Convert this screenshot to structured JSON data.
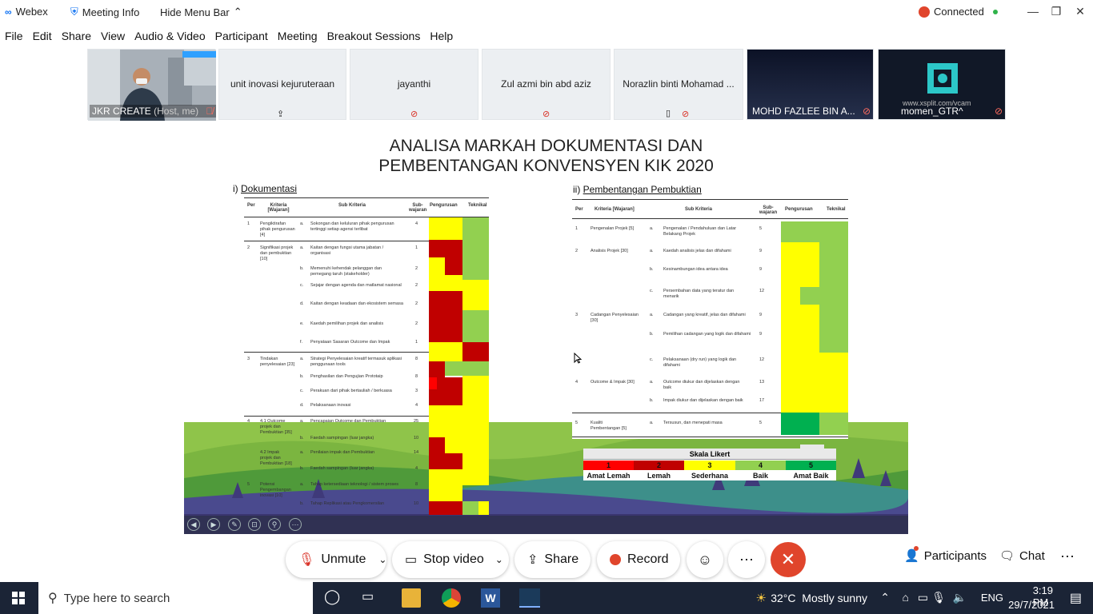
{
  "titlebar": {
    "app_name": "Webex",
    "meeting_info": "Meeting Info",
    "hide_menu": "Hide Menu Bar",
    "status": "Connected"
  },
  "menu": [
    "File",
    "Edit",
    "Share",
    "View",
    "Audio & Video",
    "Participant",
    "Meeting",
    "Breakout Sessions",
    "Help"
  ],
  "participants": [
    {
      "name": "JKR CREATE",
      "suffix": "(Host, me)"
    },
    {
      "name": "unit inovasi kejuruteraan"
    },
    {
      "name": "jayanthi"
    },
    {
      "name": "Zul azmi bin abd aziz"
    },
    {
      "name": "Norazlin binti Mohamad ..."
    },
    {
      "name": "MOHD FAZLEE BIN A..."
    },
    {
      "name": "momen_GTR^",
      "watermark": "www.xsplit.com/vcam"
    }
  ],
  "slide": {
    "title_line1": "ANALISA MARKAH DOKUMENTASI DAN",
    "title_line2": "PEMBENTANGAN KONVENSYEN KIK 2020",
    "left_section_prefix": "i)",
    "left_section": "Dokumentasi",
    "right_section_prefix": "ii)",
    "right_section": "Pembentangan Pembuktian",
    "headers": {
      "per": "Per",
      "kriteria": "Kriteria [Wajaran]",
      "sub_kriteria": "Sub Kriteria",
      "sub_wajaran": "Sub-wajaran",
      "pengurusan": "Pengurusan",
      "teknikal": "Teknikal"
    },
    "left_rows": [
      {
        "per": "1",
        "kriteria": "Pengiktirafan pihak pengurusan [4]",
        "sub": "a.",
        "text": "Sokongan dan keluluran pihak pengurusan tertinggi setiap agensi terlibat",
        "w": "4"
      },
      {
        "per": "2",
        "kriteria": "Signifikasi projek dan pembuktian [10]",
        "sub": "a.",
        "text": "Kaitan dengan fungsi utama jabatan / organisasi",
        "w": "1"
      },
      {
        "per": "",
        "kriteria": "",
        "sub": "b.",
        "text": "Memenuhi kehendak pelanggan dan pemegang taruh (stakeholder)",
        "w": "2"
      },
      {
        "per": "",
        "kriteria": "",
        "sub": "c.",
        "text": "Sejajar dengan agenda dan matlamat nasional",
        "w": "2"
      },
      {
        "per": "",
        "kriteria": "",
        "sub": "d.",
        "text": "Kaitan dengan keadaan dan ekosistem semasa",
        "w": "2"
      },
      {
        "per": "",
        "kriteria": "",
        "sub": "e.",
        "text": "Kaedah pemilihan projek dan analisis",
        "w": "2"
      },
      {
        "per": "",
        "kriteria": "",
        "sub": "f.",
        "text": "Penyataan Sasaran Outcome dan Impak",
        "w": "1"
      },
      {
        "per": "3",
        "kriteria": "Tindakan penyelesaian [23]",
        "sub": "a.",
        "text": "Strategi Penyelesaian kreatif termasuk aplikasi penggunaan tools",
        "w": "8"
      },
      {
        "per": "",
        "kriteria": "",
        "sub": "b.",
        "text": "Penghasilan dan Pengujian Prototaip",
        "w": "8"
      },
      {
        "per": "",
        "kriteria": "",
        "sub": "c.",
        "text": "Perakuan dari pihak bertauliah / berkuasa",
        "w": "3"
      },
      {
        "per": "",
        "kriteria": "",
        "sub": "d.",
        "text": "Pelaksanaan inovasi",
        "w": "4"
      },
      {
        "per": "4",
        "kriteria": "4.1 Outcome projek dan Pembuktian [35]",
        "sub": "a.",
        "text": "Pencapaian Outcome dan Pembuktian",
        "w": "25"
      },
      {
        "per": "",
        "kriteria": "",
        "sub": "b.",
        "text": "Faedah sampingan (luar jangka)",
        "w": "10"
      },
      {
        "per": "",
        "kriteria": "4.2 Impak projek dan Pembuktian [18]",
        "sub": "a.",
        "text": "Penilaian impak dan Pembuktian",
        "w": "14"
      },
      {
        "per": "",
        "kriteria": "",
        "sub": "b.",
        "text": "Faedah sampingan (luar jangka)",
        "w": "4"
      },
      {
        "per": "5",
        "kriteria": "Potensi Pengembangan inovasi [10]",
        "sub": "a.",
        "text": "Tahap ketersediaan teknologi / sistem proses",
        "w": "8"
      },
      {
        "per": "",
        "kriteria": "",
        "sub": "b.",
        "text": "Tahap Replikasi atau Pengkomersilan",
        "w": "10"
      }
    ],
    "right_rows": [
      {
        "per": "1",
        "kriteria": "Pengenalan Projek [5]",
        "sub": "a.",
        "text": "Pengenalan / Pendahuluan dan Latar Belakang Projek",
        "w": "5"
      },
      {
        "per": "2",
        "kriteria": "Analisis Projek [30]",
        "sub": "a.",
        "text": "Kaedah analisis jelas dan difahami",
        "w": "9"
      },
      {
        "per": "",
        "kriteria": "",
        "sub": "b.",
        "text": "Kesinambungan idea antara idea",
        "w": "9"
      },
      {
        "per": "",
        "kriteria": "",
        "sub": "c.",
        "text": "Persembahan data yang teratur dan menarik",
        "w": "12"
      },
      {
        "per": "3",
        "kriteria": "Cadangan Penyelesaian [30]",
        "sub": "a.",
        "text": "Cadangan yang kreatif, jelas dan difahami",
        "w": "9"
      },
      {
        "per": "",
        "kriteria": "",
        "sub": "b.",
        "text": "Pemilihan cadangan yang logik dan difahami",
        "w": "9"
      },
      {
        "per": "",
        "kriteria": "",
        "sub": "c.",
        "text": "Pelaksanaan (dry run) yang logik dan difahami",
        "w": "12"
      },
      {
        "per": "4",
        "kriteria": "Outcome & Impak [30]",
        "sub": "a.",
        "text": "Outcome diukur dan dijelaskan dengan baik",
        "w": "13"
      },
      {
        "per": "",
        "kriteria": "",
        "sub": "b.",
        "text": "Impak diukur dan dijelaskan dengan baik",
        "w": "17"
      },
      {
        "per": "5",
        "kriteria": "Kualiti Pembentangan [5]",
        "sub": "a.",
        "text": "Tersusun, dan menepati masa",
        "w": "5"
      }
    ],
    "likert": {
      "title": "Skala Likert",
      "levels": [
        {
          "n": "1",
          "label": "Amat Lemah",
          "color": "#ff0000"
        },
        {
          "n": "2",
          "label": "Lemah",
          "color": "#c00000"
        },
        {
          "n": "3",
          "label": "Sederhana",
          "color": "#ffff00"
        },
        {
          "n": "4",
          "label": "Baik",
          "color": "#92d050"
        },
        {
          "n": "5",
          "label": "Amat Baik",
          "color": "#00b050"
        }
      ]
    }
  },
  "controls": {
    "unmute": "Unmute",
    "stop_video": "Stop video",
    "share": "Share",
    "record": "Record",
    "participants": "Participants",
    "chat": "Chat"
  },
  "taskbar": {
    "search_placeholder": "Type here to search",
    "weather": "32°C  Mostly sunny",
    "lang": "ENG",
    "time": "3:19 PM",
    "date": "29/7/2021"
  }
}
